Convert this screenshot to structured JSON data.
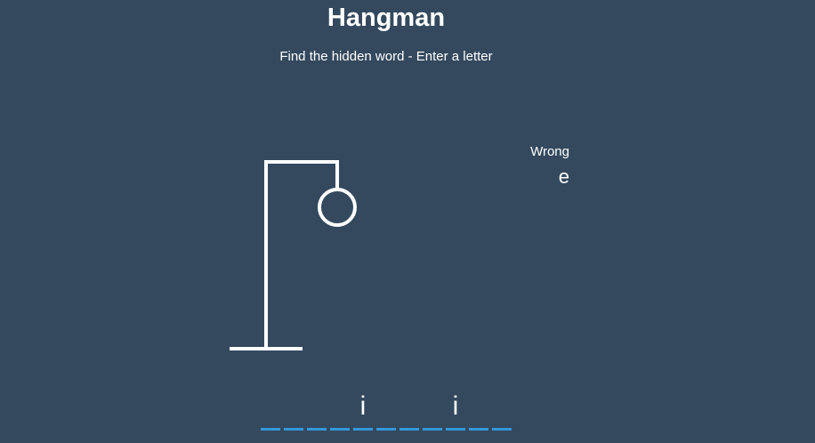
{
  "header": {
    "title": "Hangman",
    "subtitle": "Find the hidden word - Enter a letter"
  },
  "wrong": {
    "label": "Wrong",
    "letters": "e"
  },
  "word": {
    "slots": [
      "",
      "",
      "",
      "",
      "i",
      "",
      "",
      "",
      "i",
      "",
      "",
      ""
    ]
  },
  "colors": {
    "background": "#34495e",
    "figure": "#ffffff",
    "slot_underline": "#3498db"
  },
  "game_state": {
    "wrong_guess_count": 1,
    "figure_parts_shown": [
      "gallows",
      "head"
    ]
  }
}
